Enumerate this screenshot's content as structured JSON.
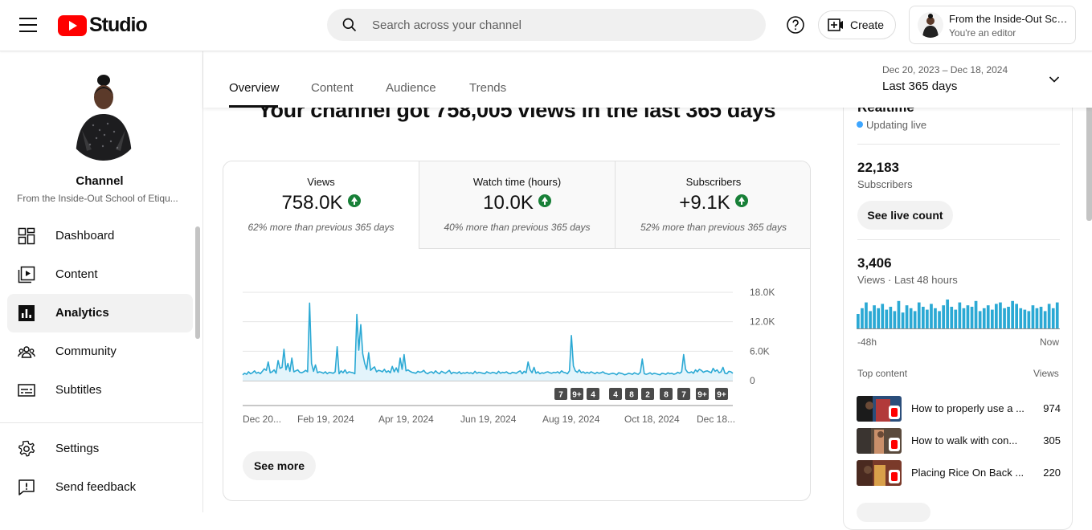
{
  "header": {
    "brand": "Studio",
    "search_placeholder": "Search across your channel",
    "create_label": "Create",
    "account_name": "From the Inside-Out Sch...",
    "account_role": "You're an editor"
  },
  "sidebar": {
    "channel_label": "Channel",
    "channel_name": "From the Inside-Out School of Etiqu...",
    "items": [
      {
        "label": "Dashboard",
        "icon": "dashboard-icon"
      },
      {
        "label": "Content",
        "icon": "content-icon"
      },
      {
        "label": "Analytics",
        "icon": "analytics-icon",
        "active": true
      },
      {
        "label": "Community",
        "icon": "community-icon"
      },
      {
        "label": "Subtitles",
        "icon": "subtitles-icon"
      }
    ],
    "bottom_items": [
      {
        "label": "Settings",
        "icon": "gear-icon"
      },
      {
        "label": "Send feedback",
        "icon": "feedback-icon"
      }
    ]
  },
  "tabs": [
    "Overview",
    "Content",
    "Audience",
    "Trends"
  ],
  "date_filter": {
    "range": "Dec 20, 2023 – Dec 18, 2024",
    "period": "Last 365 days"
  },
  "main": {
    "headline": "Your channel got 758,005 views in the last 365 days",
    "see_more_label": "See more",
    "metrics": [
      {
        "label": "Views",
        "value": "758.0K",
        "comparison": "62% more than previous 365 days"
      },
      {
        "label": "Watch time (hours)",
        "value": "10.0K",
        "comparison": "40% more than previous 365 days"
      },
      {
        "label": "Subscribers",
        "value": "+9.1K",
        "comparison": "52% more than previous 365 days"
      }
    ],
    "markers": [
      "7",
      "9+",
      "4",
      "4",
      "8",
      "2",
      "8",
      "7",
      "9+",
      "9+"
    ]
  },
  "chart_data": {
    "type": "area",
    "y_tick_labels": [
      "18.0K",
      "12.0K",
      "6.0K",
      "0"
    ],
    "y_ticks": [
      18000,
      12000,
      6000,
      0
    ],
    "ylim": [
      0,
      18000
    ],
    "x_tick_labels": [
      "Dec 20...",
      "Feb 19, 2024",
      "Apr 19, 2024",
      "Jun 19, 2024",
      "Aug 19, 2024",
      "Oct 18, 2024",
      "Dec 18..."
    ],
    "series": [
      {
        "values": [
          1200,
          1500,
          1300,
          1800,
          1400,
          1600,
          2000,
          1500,
          1700,
          1400,
          1900,
          2400,
          2100,
          3800,
          1600,
          1800,
          2200,
          1500,
          4100,
          2500,
          2700,
          6400,
          2200,
          3500,
          1900,
          4600,
          1800,
          2000,
          2200,
          1700,
          1600,
          1800,
          2100,
          1800,
          15800,
          3500,
          1900,
          3200,
          1600,
          1800,
          1700,
          1500,
          1800,
          1400,
          1700,
          1600,
          1500,
          1800,
          6900,
          1400,
          2000,
          1600,
          2200,
          1500,
          1800,
          1700,
          1600,
          1400,
          13500,
          6200,
          11400,
          5500,
          3500,
          2300,
          5700,
          2100,
          2500,
          2800,
          1800,
          2100,
          2000,
          1800,
          2300,
          1700,
          2000,
          1600,
          2900,
          1800,
          2600,
          1700,
          4600,
          2300,
          5300,
          2000,
          2200,
          1900,
          1700,
          1600,
          1500,
          1900,
          1700,
          1800,
          2100,
          1600,
          1400,
          1700,
          1800,
          1500,
          2000,
          1600,
          1400,
          1900,
          1700,
          1500,
          1800,
          2100,
          1400,
          1700,
          1600,
          1500,
          1800,
          1400,
          1600,
          1500,
          1700,
          1500,
          1600,
          1400,
          1900,
          1500,
          1700,
          1600,
          1500,
          1400,
          1800,
          1600,
          1500,
          1700,
          1600,
          1400,
          1900,
          1500,
          1700,
          1600,
          1800,
          1500,
          1400,
          1700,
          1600,
          1500,
          1800,
          2000,
          1400,
          1900,
          1600,
          3800,
          2200,
          1600,
          2700,
          1500,
          1800,
          1400,
          1600,
          1500,
          1700,
          1800,
          1600,
          1500,
          1700,
          1600,
          1800,
          1500,
          2000,
          1700,
          1600,
          1400,
          2000,
          9200,
          3000,
          2000,
          1700,
          2200,
          1600,
          1800,
          1500,
          1700,
          1500,
          1800,
          1600,
          1400,
          1700,
          1500,
          1600,
          1800,
          1500,
          1400,
          1300,
          1400,
          1500,
          1400,
          1200,
          1600,
          1500,
          1400,
          1200,
          1300,
          1500,
          1400,
          1300,
          1600,
          1400,
          1300,
          1700,
          4400,
          1400,
          1300,
          1400,
          1600,
          1300,
          1500,
          1400,
          1300,
          1200,
          1500,
          1400,
          1300,
          1600,
          1400,
          1500,
          1300,
          1400,
          1700,
          1500,
          1800,
          5300,
          2300,
          1700,
          1600,
          1800,
          1500,
          2200,
          1800,
          2300,
          2100,
          1700,
          1900,
          2000,
          1800,
          1600,
          2500,
          1900,
          2200,
          1600,
          1800,
          2700,
          1500,
          1400,
          1900,
          1800,
          1500
        ]
      }
    ]
  },
  "realtime": {
    "title": "Realtime",
    "status": "Updating live",
    "subscribers_value": "22,183",
    "subscribers_label": "Subscribers",
    "live_count_label": "See live count",
    "views_value": "3,406",
    "views_label": "Views · Last 48 hours",
    "axis_start": "-48h",
    "axis_end": "Now",
    "bars": [
      50,
      70,
      90,
      60,
      80,
      70,
      85,
      65,
      75,
      60,
      95,
      55,
      80,
      70,
      60,
      90,
      75,
      65,
      85,
      70,
      60,
      80,
      100,
      75,
      65,
      90,
      70,
      80,
      75,
      95,
      60,
      70,
      80,
      65,
      85,
      90,
      70,
      75,
      95,
      85,
      70,
      65,
      60,
      80,
      70,
      75,
      60,
      85,
      70,
      90
    ],
    "top_content_label": "Top content",
    "top_content_views_label": "Views",
    "top_content": [
      {
        "title": "How to properly use a ...",
        "views": "974"
      },
      {
        "title": "How to walk with con...",
        "views": "305"
      },
      {
        "title": "Placing Rice On Back ...",
        "views": "220"
      }
    ]
  }
}
